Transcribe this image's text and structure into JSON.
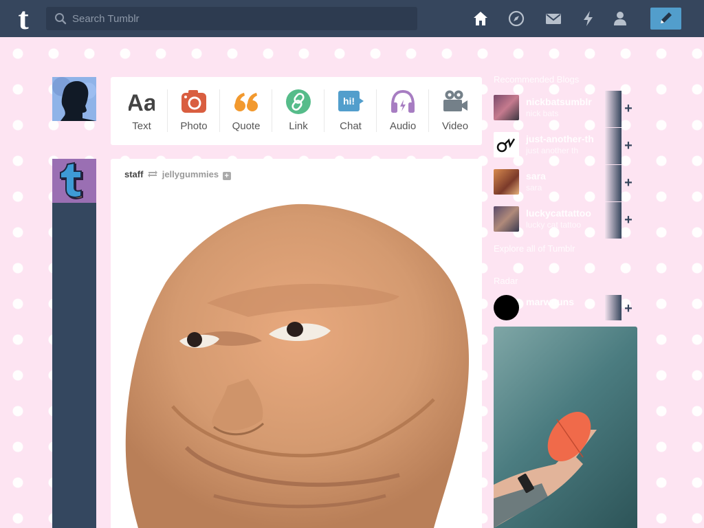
{
  "nav": {
    "logo": "t",
    "search_placeholder": "Search Tumblr",
    "icons": [
      "home-icon",
      "explore-icon",
      "inbox-icon",
      "activity-icon",
      "account-icon",
      "compose-icon"
    ],
    "colors": {
      "bar": "#36465d",
      "compose": "#529ecc"
    }
  },
  "post_types": [
    {
      "label": "Text",
      "icon": "text-icon",
      "color": "#444444"
    },
    {
      "label": "Photo",
      "icon": "photo-icon",
      "color": "#d95e40"
    },
    {
      "label": "Quote",
      "icon": "quote-icon",
      "color": "#f2992e"
    },
    {
      "label": "Link",
      "icon": "link-icon",
      "color": "#56bc8a"
    },
    {
      "label": "Chat",
      "icon": "chat-icon",
      "color": "#529ecc"
    },
    {
      "label": "Audio",
      "icon": "audio-icon",
      "color": "#a77dc2"
    },
    {
      "label": "Video",
      "icon": "video-icon",
      "color": "#748089"
    }
  ],
  "post": {
    "author": "staff",
    "reblogged_from": "jellygummies"
  },
  "sidebar": {
    "heading": "Recommended Blogs",
    "recommended": [
      {
        "name": "nickbatsumblr",
        "sub": "nick bats"
      },
      {
        "name": "just-another-th",
        "sub": "just another th"
      },
      {
        "name": "sara",
        "sub": "sara"
      },
      {
        "name": "luckycattattoo",
        "sub": "lucky cat tattoo"
      }
    ],
    "explore_link": "Explore all of Tumblr",
    "radar_heading": "Radar",
    "radar_blog": {
      "name": "marwouns",
      "sub": ""
    }
  },
  "background_color": "#fde4f2"
}
